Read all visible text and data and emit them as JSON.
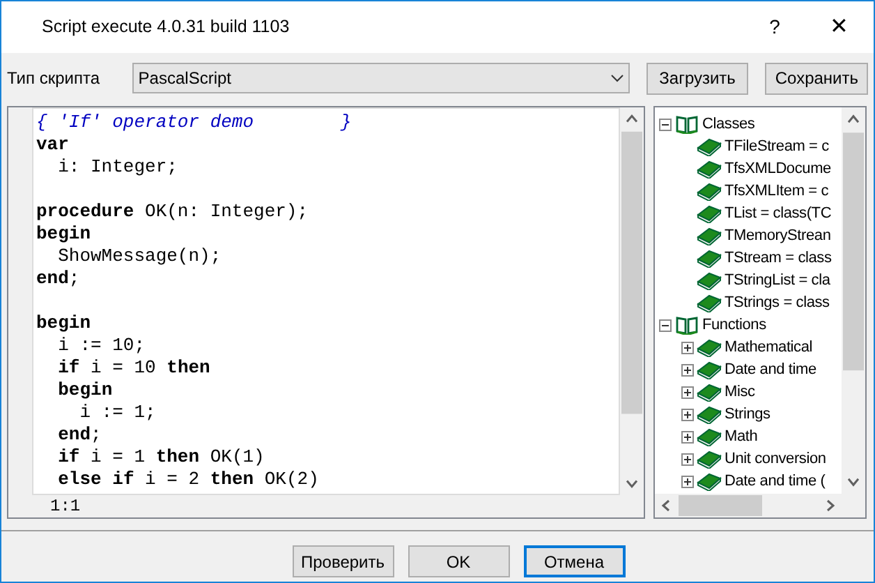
{
  "window": {
    "title": "Script execute 4.0.31 build 1103",
    "help": "?",
    "close": "✕"
  },
  "toolbar": {
    "label": "Тип скрипта",
    "script_type": "PascalScript",
    "buttons": [
      "Загрузить",
      "Сохранить"
    ]
  },
  "editor": {
    "lines": [
      {
        "kind": "comment",
        "text": "{ 'If' operator demo        }"
      },
      {
        "kind": "code",
        "text": "**var**"
      },
      {
        "kind": "code",
        "text": "  i: Integer;"
      },
      {
        "kind": "blank"
      },
      {
        "kind": "code",
        "text": "**procedure** OK(n: Integer);"
      },
      {
        "kind": "code",
        "text": "**begin**"
      },
      {
        "kind": "code",
        "text": "  ShowMessage(n);"
      },
      {
        "kind": "code",
        "text": "**end**;"
      },
      {
        "kind": "blank"
      },
      {
        "kind": "code",
        "text": "**begin**"
      },
      {
        "kind": "code",
        "text": "  i := 10;"
      },
      {
        "kind": "code",
        "text": "  **if** i = 10 **then**"
      },
      {
        "kind": "code",
        "text": "  **begin**"
      },
      {
        "kind": "code",
        "text": "    i := 1;"
      },
      {
        "kind": "code",
        "text": "  **end**;"
      },
      {
        "kind": "code",
        "text": "  **if** i = 1 **then** OK(1)"
      },
      {
        "kind": "code",
        "text": "  **else** **if** i = 2 **then** OK(2)"
      }
    ],
    "cursor": "1:1"
  },
  "tree": [
    {
      "label": "Classes",
      "expanded": true,
      "children": [
        {
          "label": "TFileStream = c"
        },
        {
          "label": "TfsXMLDocume"
        },
        {
          "label": "TfsXMLItem = c"
        },
        {
          "label": "TList = class(TC"
        },
        {
          "label": "TMemoryStrean"
        },
        {
          "label": "TStream = class"
        },
        {
          "label": "TStringList = cla"
        },
        {
          "label": "TStrings = class"
        }
      ]
    },
    {
      "label": "Functions",
      "expanded": true,
      "children": [
        {
          "label": "Mathematical",
          "expanded": false
        },
        {
          "label": "Date and time",
          "expanded": false
        },
        {
          "label": "Misc",
          "expanded": false
        },
        {
          "label": "Strings",
          "expanded": false
        },
        {
          "label": "Math",
          "expanded": false
        },
        {
          "label": "Unit conversion",
          "expanded": false
        },
        {
          "label": "Date and time (",
          "expanded": false
        }
      ]
    }
  ],
  "buttons": [
    {
      "label": "Проверить",
      "default": false
    },
    {
      "label": "OK",
      "default": false
    },
    {
      "label": "Отмена",
      "default": true
    }
  ]
}
